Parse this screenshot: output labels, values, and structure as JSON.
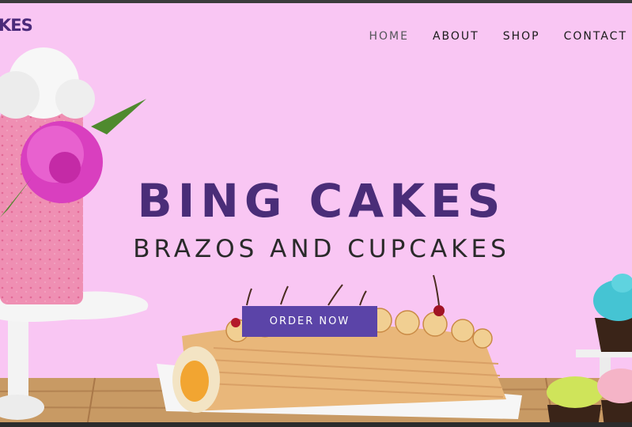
{
  "brand": {
    "logo_text": "KES"
  },
  "nav": {
    "items": [
      {
        "label": "HOME",
        "active": true
      },
      {
        "label": "ABOUT",
        "active": false
      },
      {
        "label": "SHOP",
        "active": false
      },
      {
        "label": "CONTACT",
        "active": false
      }
    ]
  },
  "hero": {
    "title": "BING CAKES",
    "subtitle": "BRAZOS AND CUPCAKES",
    "cta_label": "ORDER NOW"
  },
  "colors": {
    "background": "#f9c6f3",
    "title": "#4a2d78",
    "button": "#5b44a8"
  }
}
